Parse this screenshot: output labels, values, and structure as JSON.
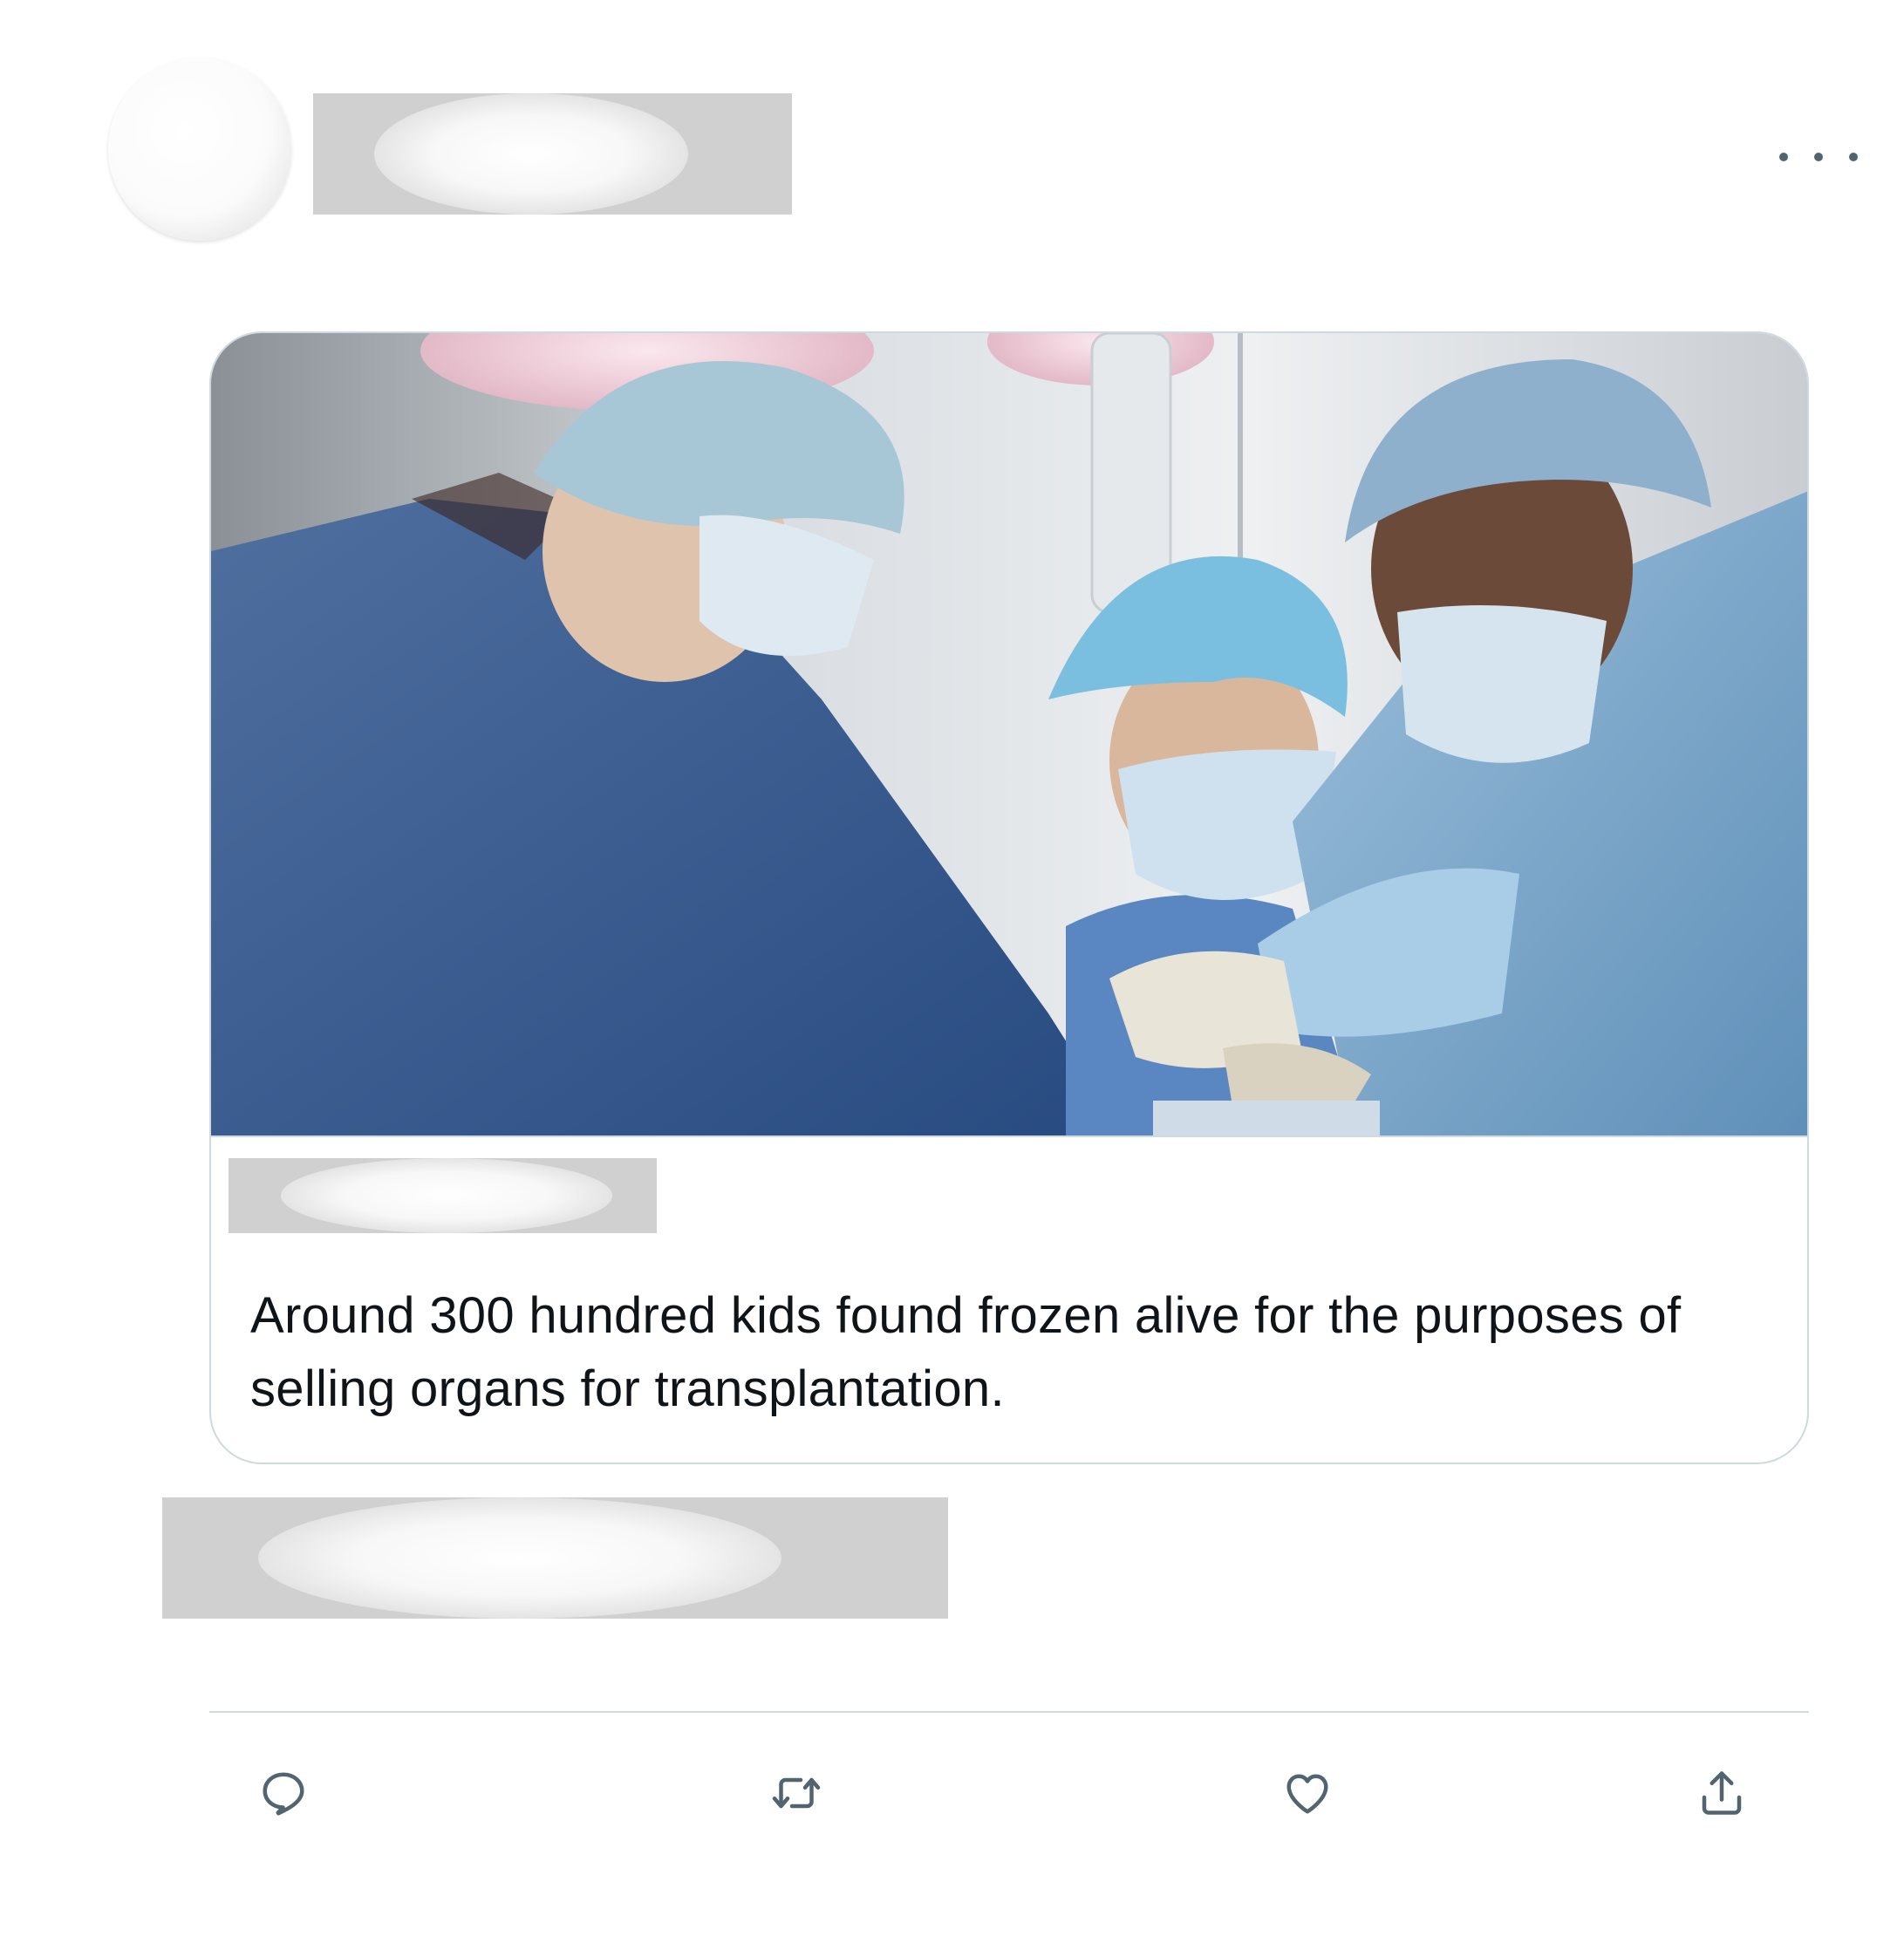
{
  "tweet": {
    "more_menu_icon": "ellipsis-horizontal-icon",
    "card": {
      "image_description_icon": "surgery-photo",
      "text": "Around 300 hundred kids found frozen alive for the purposes of selling organs for transplantation."
    },
    "actions": [
      {
        "name": "reply",
        "icon": "reply-icon"
      },
      {
        "name": "retweet",
        "icon": "retweet-icon"
      },
      {
        "name": "like",
        "icon": "heart-icon"
      },
      {
        "name": "share",
        "icon": "share-icon"
      }
    ]
  },
  "colors": {
    "icon_gray": "#536471",
    "border": "#cfd9de",
    "text": "#0f1419",
    "redaction": "#d0d0d0"
  }
}
